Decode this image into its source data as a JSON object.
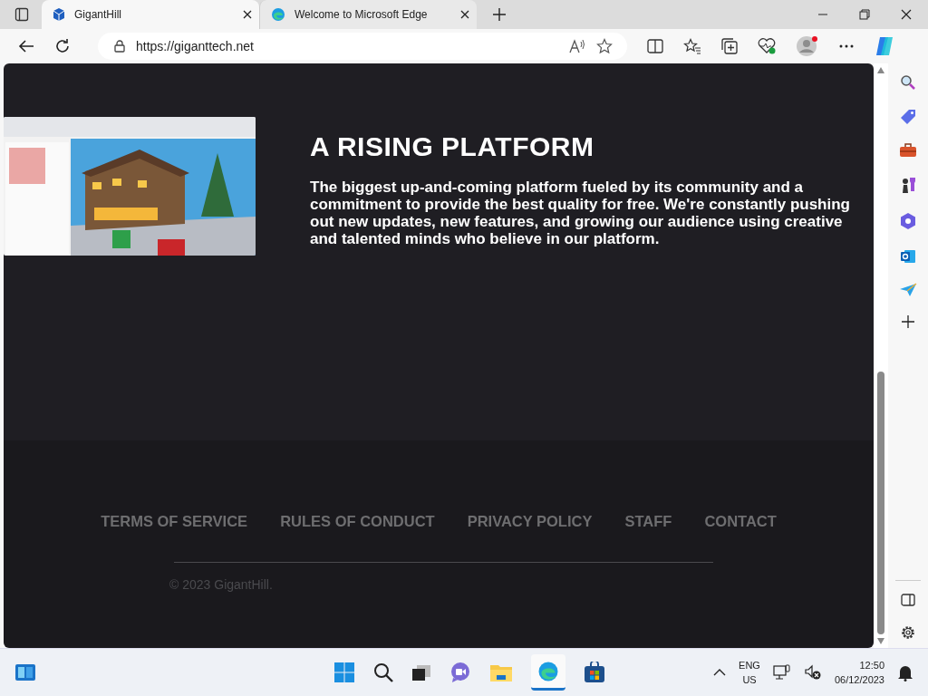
{
  "tabs": [
    {
      "title": "GigantHill",
      "selected": true,
      "kind": "site"
    },
    {
      "title": "Welcome to Microsoft Edge",
      "selected": false,
      "kind": "edge"
    }
  ],
  "address_bar": {
    "url": "https://giganttech.net"
  },
  "page": {
    "hero": {
      "heading": "A RISING PLATFORM",
      "text": "The biggest up-and-coming platform fueled by its community and a commitment to provide the best quality for free. We're constantly pushing out new updates, new features, and growing our audience using creative and talented minds who believe in our platform."
    },
    "footer": {
      "links": [
        "TERMS OF SERVICE",
        "RULES OF CONDUCT",
        "PRIVACY POLICY",
        "STAFF",
        "CONTACT"
      ],
      "copyright": "© 2023 GigantHill."
    }
  },
  "taskbar": {
    "language": "ENG",
    "region": "US",
    "time": "12:50",
    "date": "06/12/2023"
  }
}
